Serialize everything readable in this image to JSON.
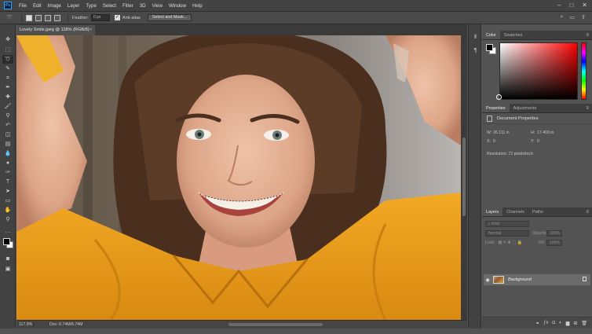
{
  "app": {
    "logo": "Ps"
  },
  "menu": [
    "File",
    "Edit",
    "Image",
    "Layer",
    "Type",
    "Select",
    "Filter",
    "3D",
    "View",
    "Window",
    "Help"
  ],
  "window_buttons": [
    "–",
    "□",
    "✕"
  ],
  "options": {
    "feather_label": "Feather:",
    "feather_value": "0 px",
    "antialias_label": "Anti-alias",
    "select_mask_label": "Select and Mask..."
  },
  "document": {
    "tab_title": "Lovely Smile.jpeg @ 118% (RGB/8)",
    "tab_close": "×",
    "zoom": "117.9%",
    "doc_info": "Doc: 6.74M/6.74M"
  },
  "panels": {
    "color_tabs": [
      "Color",
      "Swatches"
    ],
    "properties_tabs": [
      "Properties",
      "Adjustments"
    ],
    "properties_title": "Document Properties",
    "props": {
      "w_label": "W:",
      "w_value": "26.111 in",
      "h_label": "H:",
      "h_value": "17.403 in",
      "x_label": "X:",
      "x_value": "0",
      "y_label": "Y:",
      "y_value": "0",
      "resolution": "Resolution: 72 pixels/inch"
    },
    "layers_tabs": [
      "Layers",
      "Channels",
      "Paths"
    ],
    "layers_kind": "Kind",
    "layers_blend": "Normal",
    "layers_opacity_label": "Opacity:",
    "layers_opacity_value": "100%",
    "layers_lock_label": "Lock:",
    "layers_fill_label": "Fill:",
    "layers_fill_value": "100%",
    "layer_name": "Background"
  },
  "colors": {
    "foreground": "#000000",
    "background": "#ffffff",
    "ui_dark": "#424242",
    "ui_panel": "#535353"
  }
}
